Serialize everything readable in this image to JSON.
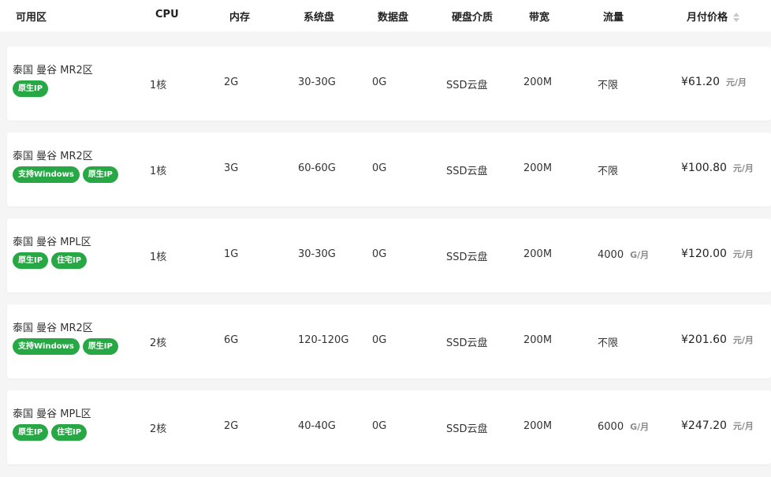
{
  "header": {
    "zone": "可用区",
    "cpu": "CPU",
    "memory": "内存",
    "system_disk": "系统盘",
    "data_disk": "数据盘",
    "disk_type": "硬盘介质",
    "bandwidth": "带宽",
    "traffic": "流量",
    "price": "月付价格"
  },
  "rows": [
    {
      "zone": "泰国 曼谷 MR2区",
      "tags": [
        "原生IP"
      ],
      "cpu": "1核",
      "memory": "2G",
      "system_disk": "30-30G",
      "data_disk": "0G",
      "disk_type": "SSD云盘",
      "bandwidth": "200M",
      "traffic": "不限",
      "traffic_unit": "",
      "price": "¥61.20",
      "price_unit": "元/月"
    },
    {
      "zone": "泰国 曼谷 MR2区",
      "tags": [
        "支持Windows",
        "原生IP"
      ],
      "cpu": "1核",
      "memory": "3G",
      "system_disk": "60-60G",
      "data_disk": "0G",
      "disk_type": "SSD云盘",
      "bandwidth": "200M",
      "traffic": "不限",
      "traffic_unit": "",
      "price": "¥100.80",
      "price_unit": "元/月"
    },
    {
      "zone": "泰国 曼谷 MPL区",
      "tags": [
        "原生IP",
        "住宅IP"
      ],
      "cpu": "1核",
      "memory": "1G",
      "system_disk": "30-30G",
      "data_disk": "0G",
      "disk_type": "SSD云盘",
      "bandwidth": "200M",
      "traffic": "4000",
      "traffic_unit": "G/月",
      "price": "¥120.00",
      "price_unit": "元/月"
    },
    {
      "zone": "泰国 曼谷 MR2区",
      "tags": [
        "支持Windows",
        "原生IP"
      ],
      "cpu": "2核",
      "memory": "6G",
      "system_disk": "120-120G",
      "data_disk": "0G",
      "disk_type": "SSD云盘",
      "bandwidth": "200M",
      "traffic": "不限",
      "traffic_unit": "",
      "price": "¥201.60",
      "price_unit": "元/月"
    },
    {
      "zone": "泰国 曼谷 MPL区",
      "tags": [
        "原生IP",
        "住宅IP"
      ],
      "cpu": "2核",
      "memory": "2G",
      "system_disk": "40-40G",
      "data_disk": "0G",
      "disk_type": "SSD云盘",
      "bandwidth": "200M",
      "traffic": "6000",
      "traffic_unit": "G/月",
      "price": "¥247.20",
      "price_unit": "元/月"
    }
  ],
  "colors": {
    "tag_background": "#27a844",
    "page_background": "#f5f5f5"
  },
  "icons": {
    "sort": "sort-icon"
  }
}
